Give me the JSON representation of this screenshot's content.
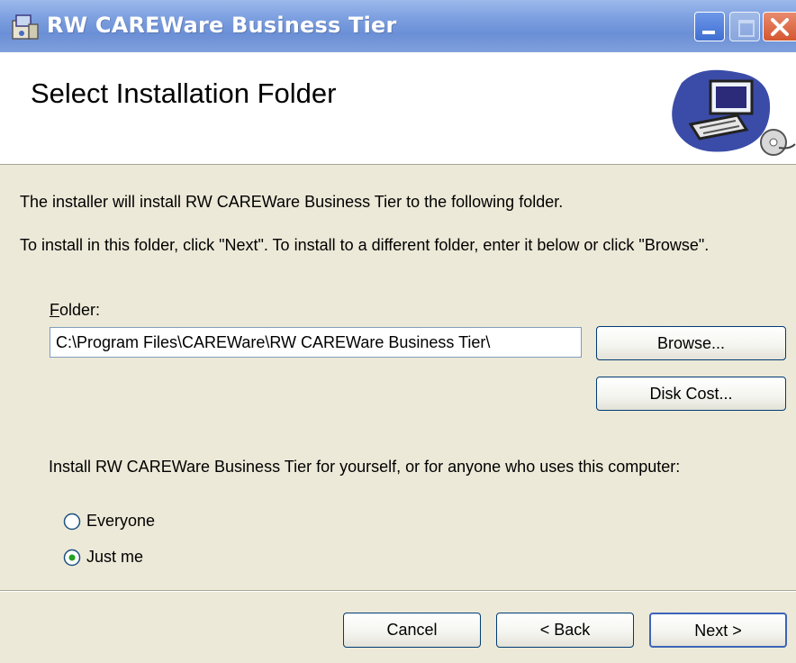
{
  "window": {
    "title": "RW CAREWare Business Tier"
  },
  "banner": {
    "title": "Select Installation Folder"
  },
  "intro": {
    "line1": "The installer will install RW CAREWare Business Tier to the following folder.",
    "line2": "To install in this folder, click \"Next\". To install to a different folder, enter it below or click \"Browse\"."
  },
  "folder": {
    "label_accel": "F",
    "label_rest": "older:",
    "value": "C:\\Program Files\\CAREWare\\RW CAREWare Business Tier\\"
  },
  "buttons": {
    "browse": "Browse...",
    "disk_cost": "Disk Cost...",
    "cancel": "Cancel",
    "back": "< Back",
    "next": "Next >"
  },
  "install_for": {
    "prompt": "Install RW CAREWare Business Tier for yourself, or for anyone who uses this computer:",
    "options": [
      {
        "label": "Everyone",
        "selected": false
      },
      {
        "label": "Just me",
        "selected": true
      }
    ]
  },
  "icons": [
    "installer-app-icon",
    "minimize-icon",
    "maximize-icon",
    "close-icon",
    "computer-setup-icon",
    "radio-icon"
  ]
}
